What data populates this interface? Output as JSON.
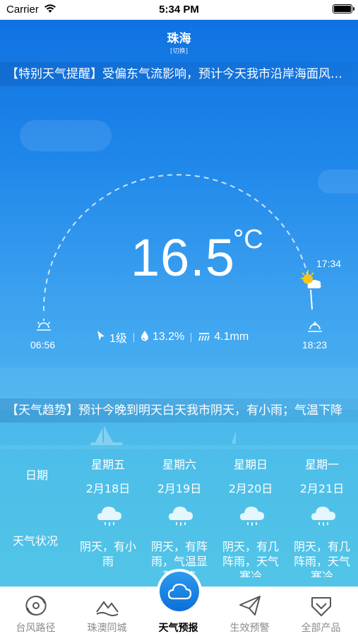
{
  "status_bar": {
    "carrier": "Carrier",
    "time": "5:34 PM",
    "battery_percent": 100
  },
  "header": {
    "city": "珠海",
    "switch_label": "[切换]"
  },
  "alert": {
    "text": "【特别天气提醒】受偏东气流影响，预计今天我市沿岸海面风力明显加大"
  },
  "current": {
    "temperature": "16.5",
    "unit": "°C",
    "sunrise": "06:56",
    "sunset": "18:23",
    "now_time": "17:34",
    "wind": "1级",
    "humidity": "13.2%",
    "rainfall": "4.1mm"
  },
  "trend": {
    "text": "【天气趋势】预计今晚到明天白天我市阴天，有小雨；气温下降"
  },
  "forecast": {
    "date_label": "日期",
    "weather_label": "天气状况",
    "days": [
      {
        "weekday": "星期五",
        "date": "2月18日",
        "desc": "阴天，有小雨",
        "icon": "cloud-rain-icon"
      },
      {
        "weekday": "星期六",
        "date": "2月19日",
        "desc": "阴天，有阵雨，气温显著下降",
        "icon": "cloud-rain-icon"
      },
      {
        "weekday": "星期日",
        "date": "2月20日",
        "desc": "阴天，有几阵雨，天气寒冷",
        "icon": "cloud-rain-icon"
      },
      {
        "weekday": "星期一",
        "date": "2月21日",
        "desc": "阴天，有几阵雨，天气寒冷",
        "icon": "cloud-rain-icon"
      }
    ]
  },
  "tabs": [
    {
      "label": "台风路径",
      "icon": "typhoon-icon",
      "active": false
    },
    {
      "label": "珠澳同城",
      "icon": "mountain-icon",
      "active": false
    },
    {
      "label": "天气预报",
      "icon": "cloud-icon",
      "active": true
    },
    {
      "label": "生效预警",
      "icon": "paper-plane-icon",
      "active": false
    },
    {
      "label": "全部产品",
      "icon": "chevron-shield-icon",
      "active": false
    }
  ],
  "colors": {
    "sky_top": "#0d6fe0",
    "sky_bottom": "#53c7e6",
    "tab_inactive": "#8a8a8a",
    "tab_active_button": "#1a85e6"
  }
}
